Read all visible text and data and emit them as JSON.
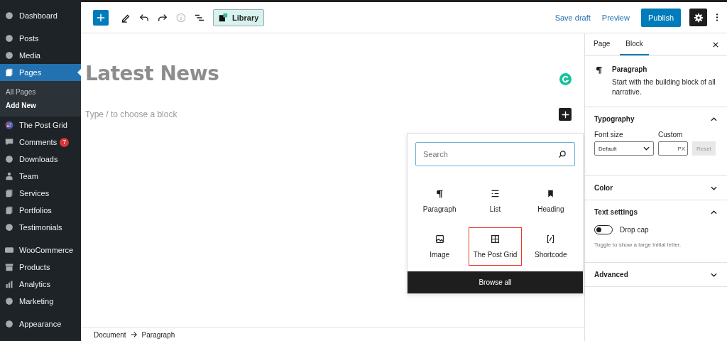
{
  "sidebar": {
    "groups": [
      [
        {
          "label": "Dashboard",
          "selected": false
        }
      ],
      [
        {
          "label": "Posts",
          "selected": false
        },
        {
          "label": "Media",
          "selected": false
        },
        {
          "label": "Pages",
          "selected": true,
          "submenu": [
            {
              "label": "All Pages",
              "selected": false
            },
            {
              "label": "Add New",
              "selected": true
            }
          ]
        },
        {
          "label": "The Post Grid",
          "selected": false
        },
        {
          "label": "Comments",
          "selected": false,
          "badge": "7"
        },
        {
          "label": "Downloads",
          "selected": false
        },
        {
          "label": "Team",
          "selected": false
        },
        {
          "label": "Services",
          "selected": false
        },
        {
          "label": "Portfolios",
          "selected": false
        },
        {
          "label": "Testimonials",
          "selected": false
        }
      ],
      [
        {
          "label": "WooCommerce",
          "selected": false
        },
        {
          "label": "Products",
          "selected": false
        },
        {
          "label": "Analytics",
          "selected": false
        },
        {
          "label": "Marketing",
          "selected": false
        }
      ],
      [
        {
          "label": "Appearance",
          "selected": false
        }
      ]
    ]
  },
  "toolbar": {
    "tools": [
      {
        "disabled": false
      },
      {
        "disabled": false
      },
      {
        "disabled": false
      },
      {
        "disabled": true
      },
      {
        "disabled": false
      },
      {
        "disabled": false
      }
    ],
    "library": "Library",
    "save_draft": "Save draft",
    "preview": "Preview",
    "publish": "Publish"
  },
  "editor": {
    "title": "Latest News",
    "placeholder": "Type / to choose a block",
    "inserter": {
      "search": {
        "placeholder": "Search"
      },
      "blocks": [
        {
          "label": "Paragraph",
          "highlighted": false
        },
        {
          "label": "List",
          "highlighted": false
        },
        {
          "label": "Heading",
          "highlighted": false
        },
        {
          "label": "Image",
          "highlighted": false
        },
        {
          "label": "The Post Grid",
          "highlighted": true
        },
        {
          "label": "Shortcode",
          "highlighted": false
        }
      ],
      "browse_all": "Browse all"
    },
    "breadcrumb": [
      "Document",
      "Paragraph"
    ]
  },
  "settings": {
    "tabs": [
      {
        "label": "Page",
        "selected": false
      },
      {
        "label": "Block",
        "selected": true
      }
    ],
    "block": {
      "name": "Paragraph",
      "description": "Start with the building block of all narrative."
    },
    "panels": [
      {
        "title": "Typography",
        "expanded": true,
        "kind": "typography",
        "font_size_label": "Font size",
        "font_size": "Default",
        "custom_label": "Custom",
        "unit": "PX",
        "reset": "Reset"
      },
      {
        "title": "Color",
        "expanded": false
      },
      {
        "title": "Text settings",
        "expanded": true,
        "kind": "text",
        "toggle_label": "Drop cap",
        "on": false,
        "help": "Toggle to show a large initial letter."
      },
      {
        "title": "Advanced",
        "expanded": false
      }
    ]
  }
}
